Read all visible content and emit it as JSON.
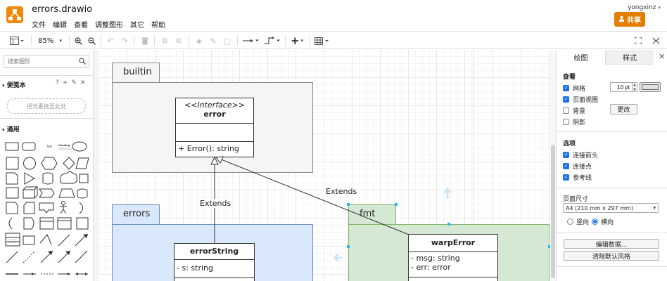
{
  "app": {
    "title": "errors.drawio",
    "menu": [
      "文件",
      "编辑",
      "查看",
      "调整图形",
      "其它",
      "帮助"
    ],
    "user": "yongxinz",
    "share_label": "共享"
  },
  "toolbar": {
    "zoom": "85%"
  },
  "left_panel": {
    "search_placeholder": "搜索图形",
    "scratchpad_title": "便笺本",
    "scratchpad_help": "?",
    "dropzone_text": "把元素拖至此处",
    "general_title": "通用",
    "shape_text_label": "Text",
    "shape_heading_label": "Heading"
  },
  "diagram": {
    "packages": [
      {
        "name": "builtin"
      },
      {
        "name": "errors"
      },
      {
        "name": "fmt"
      }
    ],
    "classes": {
      "error": {
        "stereotype": "<<Interface>>",
        "name": "error",
        "methods": "+ Error(): string"
      },
      "errorString": {
        "name": "errorString",
        "fields": "- s: string"
      },
      "warpError": {
        "name": "warpError",
        "fields": [
          "- msg: string",
          "- err: error"
        ]
      }
    },
    "edges": [
      "Extends",
      "Extends"
    ]
  },
  "right_panel": {
    "tabs": [
      "绘图",
      "样式"
    ],
    "view_title": "查看",
    "grid_label": "网格",
    "grid_size": "10 pt",
    "page_view_label": "页面视图",
    "background_label": "背景",
    "change_label": "更改",
    "shadow_label": "阴影",
    "options_title": "选项",
    "connection_arrows_label": "连接箭头",
    "connection_points_label": "连接点",
    "guides_label": "参考线",
    "paper_size_title": "页面尺寸",
    "paper_size_value": "A4 (210 mm x 297 mm)",
    "portrait_label": "竖向",
    "landscape_label": "横向",
    "edit_data_label": "编辑数据...",
    "clear_style_label": "清除默认风格",
    "checks": {
      "grid": true,
      "page_view": true,
      "background": false,
      "shadow": false,
      "connection_arrows": true,
      "connection_points": true,
      "guides": true
    },
    "orientation": "landscape"
  },
  "colors": {
    "accent": "#e57e00",
    "logo": "#f08705",
    "errors_package_fill": "#dae8fc",
    "errors_package_stroke": "#6c8ebf",
    "fmt_package_fill": "#d5e8d4",
    "fmt_package_stroke": "#82b366",
    "builtin_package_fill": "#f5f5f5"
  }
}
